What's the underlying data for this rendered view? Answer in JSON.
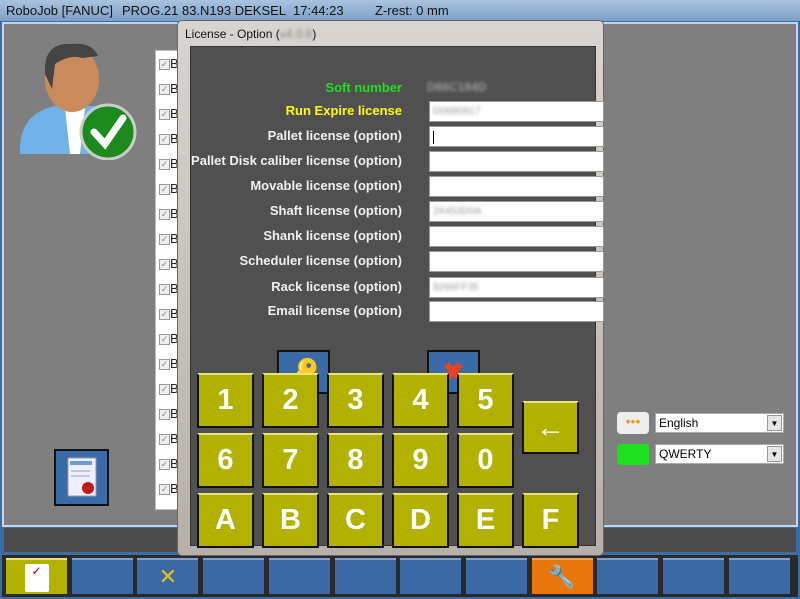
{
  "topbar": {
    "app": "RoboJob [FANUC]",
    "program": "PROG.21 83.N193 DEKSEL",
    "time": "17:44:23",
    "zrest": "Z-rest: 0 mm"
  },
  "checklist": {
    "item_label": "B",
    "count": 18
  },
  "language": {
    "selected": "English"
  },
  "keyboard_layout": {
    "selected": "QWERTY"
  },
  "dialog": {
    "title": "License - Option (",
    "version": "v4.0.6",
    "title_end": ")",
    "soft_number_label": "Soft number",
    "soft_number_value": "D86C184D",
    "fields": [
      {
        "label": "Run Expire license",
        "value": "D06B0917",
        "color": "#ffff00"
      },
      {
        "label": "Pallet license (option)",
        "value": ""
      },
      {
        "label": "Pallet Disk caliber license (option)",
        "value": ""
      },
      {
        "label": "Movable license (option)",
        "value": ""
      },
      {
        "label": "Shaft  license (option)",
        "value": "2A453D0A"
      },
      {
        "label": "Shank license (option)",
        "value": ""
      },
      {
        "label": "Scheduler  license (option)",
        "value": ""
      },
      {
        "label": "Rack  license (option)",
        "value": "8266FF35"
      },
      {
        "label": "Email license (option)",
        "value": ""
      }
    ],
    "keys": [
      "1",
      "2",
      "3",
      "4",
      "5",
      "6",
      "7",
      "8",
      "9",
      "0",
      "A",
      "B",
      "C",
      "D",
      "E",
      "F"
    ],
    "backspace": "←",
    "ok_icon": "keys-icon",
    "cancel_icon": "red-x-icon",
    "colors": {
      "soft_number": "#22dd22",
      "key": "#b3b100"
    }
  }
}
